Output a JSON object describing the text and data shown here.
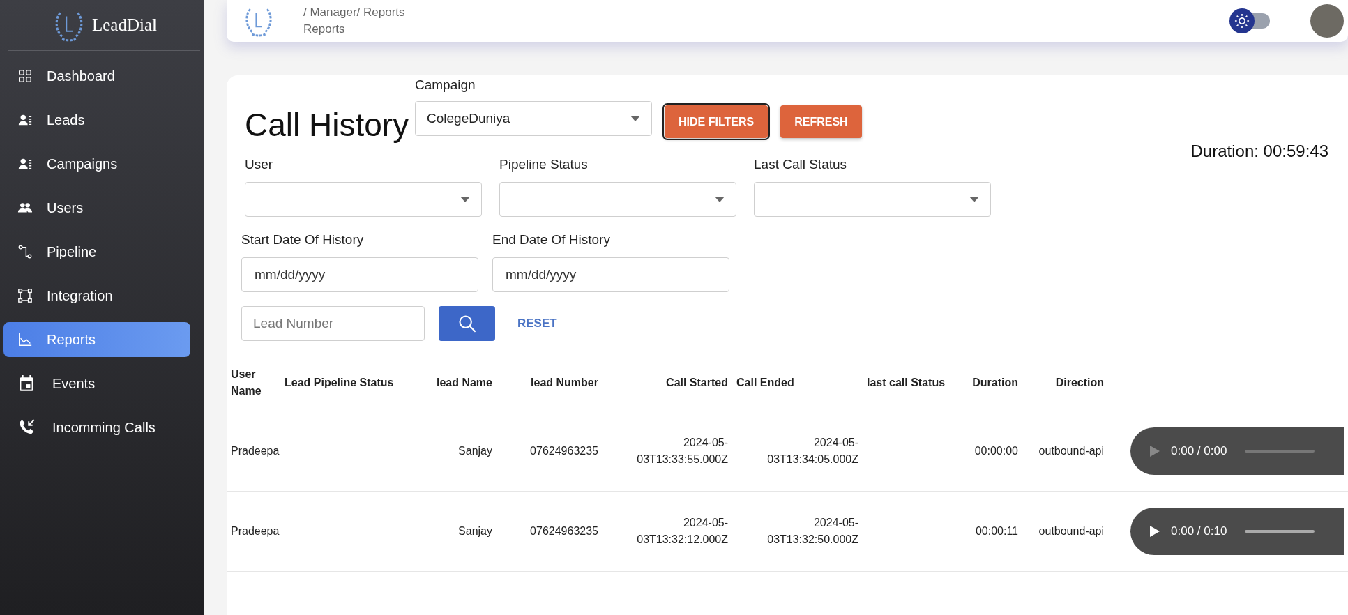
{
  "sidebar": {
    "brand": "LeadDial",
    "items": [
      {
        "label": "Dashboard",
        "kind": "grid",
        "selected": false
      },
      {
        "label": "Leads",
        "kind": "contact",
        "selected": false
      },
      {
        "label": "Campaigns",
        "kind": "contact",
        "selected": false
      },
      {
        "label": "Users",
        "kind": "people",
        "selected": false
      },
      {
        "label": "Pipeline",
        "kind": "pipeline",
        "selected": false
      },
      {
        "label": "Integration",
        "kind": "integration",
        "selected": false
      },
      {
        "label": "Reports",
        "kind": "chart",
        "selected": true
      },
      {
        "label": "Events",
        "kind": "calendar",
        "selected": false
      },
      {
        "label": "Incomming Calls",
        "kind": "phone",
        "selected": false
      }
    ]
  },
  "header": {
    "breadcrumb": "/ Manager/ Reports",
    "page": "Reports",
    "theme_toggle": {
      "on": false
    }
  },
  "main": {
    "title": "Call History",
    "campaign": {
      "label": "Campaign",
      "value": "ColegeDuniya"
    },
    "buttons": [
      {
        "label": "HIDE FILTERS",
        "focused": true
      },
      {
        "label": "REFRESH",
        "focused": false
      }
    ],
    "duration": "Duration: 00:59:43",
    "filters": [
      {
        "label": "User"
      },
      {
        "label": "Pipeline Status"
      },
      {
        "label": "Last Call Status"
      }
    ],
    "dates": [
      {
        "label": "Start Date Of History",
        "placeholder": "mm/dd/yyyy"
      },
      {
        "label": "End Date Of History",
        "placeholder": "mm/dd/yyyy"
      }
    ],
    "lead_number": {
      "placeholder": "Lead Number"
    },
    "reset": "RESET"
  },
  "table": {
    "columns": [
      "User Name",
      "Lead Pipeline Status",
      "lead Name",
      "lead Number",
      "Call Started",
      "Call Ended",
      "last call Status",
      "Duration",
      "Direction"
    ],
    "rows": [
      {
        "cells": [
          "Pradeepa",
          "",
          "Sanjay",
          "07624963235",
          "2024-05-03T13:33:55.000Z",
          "2024-05-03T13:34:05.000Z",
          "",
          "00:00:00",
          "outbound-api"
        ],
        "audio": {
          "time": "0:00 / 0:00",
          "disabled": true
        }
      },
      {
        "cells": [
          "Pradeepa",
          "",
          "Sanjay",
          "07624963235",
          "2024-05-03T13:32:12.000Z",
          "2024-05-03T13:32:50.000Z",
          "",
          "00:00:11",
          "outbound-api"
        ],
        "audio": {
          "time": "0:00 / 0:10",
          "disabled": false
        }
      }
    ]
  }
}
